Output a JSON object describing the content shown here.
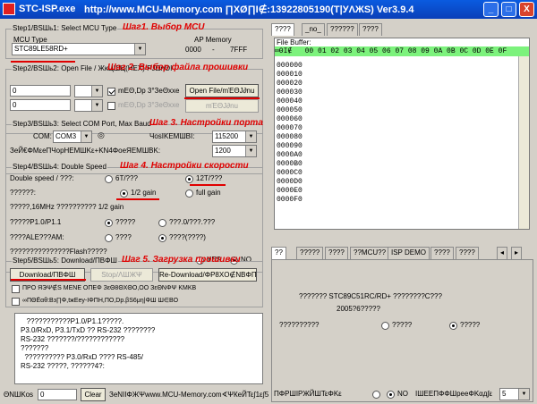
{
  "window": {
    "title_app": "STC-ISP.exe",
    "title_url": "http://www.MCU-Memory.com ∏ΧØ∏Ι∉:13922805190(Τ|УΛЖS) Ver3.9.4",
    "buttons": [
      "_",
      "□",
      "X"
    ]
  },
  "step1": {
    "title": "Step1/ΒSШь1: Select MCU Type",
    "annotation": "Шаг1. Выбор MCU",
    "mcu_type_label": "MCU Type",
    "mcu_type_value": "STC89LE58RD+",
    "ap_memory_label": "AP Memory",
    "ap_memory_from": "0000",
    "ap_memory_dash": "-",
    "ap_memory_to": "7FFF"
  },
  "step2": {
    "title": "Step2/ΒSШь2: Open File / ЖκЦШЦ(HEX) ΡJΩηΘΙ",
    "annotation": "Шаг 2. Выбор файла прошивки",
    "edit1_value": "0",
    "edit2_value": "0",
    "chk1_label": "mΕΘ,Dp 3°ЗeΘxхе",
    "chk2_label": "mΕΘ,Dp 3°ЗeΘxхе",
    "open_btn1": "Open File/mΈΘJ∂nu",
    "open_btn2": "mΈΘJ∂nu"
  },
  "step3": {
    "title": "Step3/ΒSШь3: Select COM Port, Max Baud",
    "annotation": "Шаг 3. Настройки порта",
    "com_label": "COM:",
    "com_value": "COM3",
    "max_baud_label": "ЧοsΙΚЕMШВΙ:",
    "max_baud_value": "115200",
    "min_baud_label": "ЗеЙ€ΦМεеПЧорΗЕМШΚε+ΚΝ4ΦοеЯЕМШВΚ:",
    "min_baud_value": "1200"
  },
  "step4": {
    "title": "Step4/ΒSШь4: Double Speed",
    "annotation": "Шаг 4. Настройки скорости",
    "double_speed_label": "Double speed / ???:",
    "opt_6t": "6T/???",
    "opt_12t": "12T/???",
    "row2_label": "??????:",
    "opt_half": "1/2 gain",
    "opt_full": "full gain",
    "row3_label": "?????,16MHz ?????????? 1/2 gain",
    "row4_label": "?????P1.0/P1.1",
    "row4_opt1": "?????",
    "row4_opt2": "???.0/???.???",
    "row5_label": "????ALE???ΑΜ:",
    "row5_opt1": "????",
    "row5_opt2": "????(????)",
    "row6_label": "???????????????Flash?????",
    "yes": "YES",
    "no": "NO"
  },
  "step5": {
    "title": "Step5/ΒSШь5: Download/ΠΒΦШ",
    "annotation": "Шаг 5. Загрузка прошивки",
    "download_btn": "Download/ΠΒΦШ",
    "stop_btn": "Stop/ΛШЖΨ",
    "reload_btn": "Re-Download/ΦΡ8ΧΟ∉ΝΒΦΠ",
    "chk1_text": "ΠΡΟ ЯЭΨ∉S ΜΕΝΕ ΟΠΕΦ ЗεΘ8ΘΧΘΟ,ΟΟ ЗεΘΝΦΨ ΚΜΚΒ",
    "chk2_text": "∞ΠΘЁαθ:Βз∏Φ,tжΕey-ΙΦΠΗ,ΠΟ,Dp.βS6μη|ΦШ Ш∈ΒΟ"
  },
  "log_lines": [
    "   ???????????P1.0/P1.1?????.",
    "P3.0/RxD, P3.1/TxD ?? RS-232 ????????",
    "RS-232 ???????/????????????",
    "???????",
    "  ?????????? P3.0/RxD ???? RS-485/",
    "RS-232 ?????, ??????4?:"
  ],
  "statusbar": {
    "label": "ΘΝШΚοs",
    "value": "0",
    "clear_btn": "Clear",
    "web_text": "ЗеΝΙΙΦЖΨwww.MCU-Memory.com∢ΨКеЙΤε∫1ε∫5"
  },
  "top_tabs": [
    "????",
    "_no_",
    "??????",
    "????"
  ],
  "file_buffer": {
    "label": "File Buffer:",
    "header": "∞ΘΙ∉   00 01 02 03 04 05 06 07 08 09 0A 0B 0C 0D 0E 0F",
    "addresses": [
      "000000",
      "000010",
      "000020",
      "000030",
      "000040",
      "000050",
      "000060",
      "000070",
      "000080",
      "000090",
      "0000A0",
      "0000B0",
      "0000C0",
      "0000D0",
      "0000E0",
      "0000F0"
    ]
  },
  "bottom_tabs": [
    "??",
    "?????",
    "????",
    "??MCU??",
    "ISP DEMO",
    "????",
    "????"
  ],
  "bottom_panel": {
    "text1": "??????? STC89C51RC/RD+ ????????C???",
    "text2": "2005?6?????",
    "text3": "??????????",
    "opt_a": "?????",
    "opt_b": "?????"
  },
  "footer_right": {
    "label": "ΠΦΡШΙΡЖЙШΤεΦΚε",
    "no": "NO",
    "label2": "ΙШΕΕΠΦΦШрееΦΚαд∫ε",
    "combo_value": "5"
  }
}
